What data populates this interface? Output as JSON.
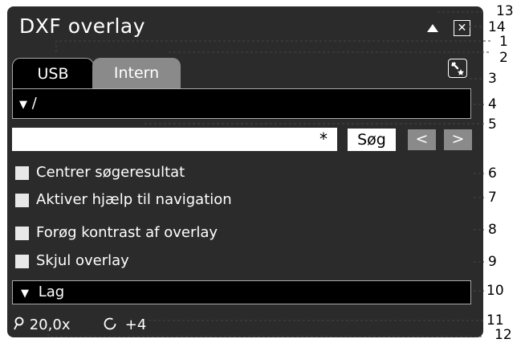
{
  "window": {
    "title": "DXF overlay"
  },
  "tabs": [
    {
      "label": "USB",
      "active": true
    },
    {
      "label": "Intern",
      "active": false
    }
  ],
  "path": {
    "label": "/"
  },
  "search": {
    "value": "",
    "required_marker": "*",
    "button_label": "Søg",
    "prev_label": "<",
    "next_label": ">"
  },
  "options": [
    {
      "label": "Centrer søgeresultat",
      "checked": false
    },
    {
      "label": "Aktiver hjælp til navigation",
      "checked": false
    },
    {
      "label": "Forøg kontrast af overlay",
      "checked": false
    },
    {
      "label": "Skjul overlay",
      "checked": false
    }
  ],
  "layers": {
    "label": "Lag"
  },
  "status": {
    "zoom": "20,0x",
    "rotation": "+4"
  },
  "callouts": [
    "1",
    "2",
    "3",
    "4",
    "5",
    "6",
    "7",
    "8",
    "9",
    "10",
    "11",
    "12",
    "13",
    "14"
  ],
  "colors": {
    "panel": "#2b2b2b",
    "tab_inactive": "#8a8a8a",
    "field": "#000000",
    "text": "#ffffff"
  }
}
